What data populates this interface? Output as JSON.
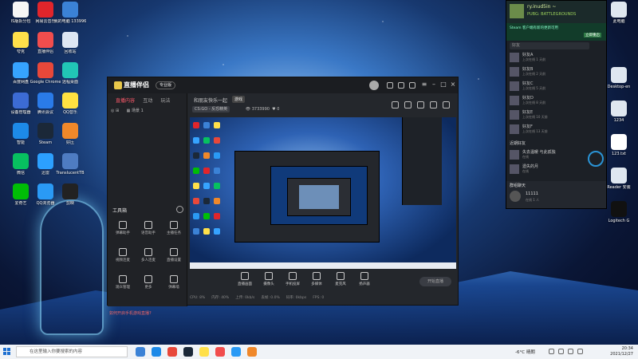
{
  "desktop": {
    "icons": [
      {
        "label": "IS版拆分包",
        "color": "#f6f6f6"
      },
      {
        "label": "网易云音乐",
        "color": "#e1252b"
      },
      {
        "label": "我的电脑 133996",
        "color": "#3b82d6"
      },
      {
        "label": "夸克",
        "color": "#ffe04a"
      },
      {
        "label": "直播伴侣",
        "color": "#f14d4d"
      },
      {
        "label": "回收站",
        "color": "#dde6f3"
      },
      {
        "label": "百度网盘",
        "color": "#36a3ff"
      },
      {
        "label": "Google Chrome",
        "color": "#e8483a"
      },
      {
        "label": "远程桌面",
        "color": "#21c6b6"
      },
      {
        "label": "设备管理器",
        "color": "#3c6bd4"
      },
      {
        "label": "腾讯会议",
        "color": "#2a7be8"
      },
      {
        "label": "QQ音乐",
        "color": "#ffe141"
      },
      {
        "label": "智能",
        "color": "#1d8ae8"
      },
      {
        "label": "Steam",
        "color": "#1b2838"
      },
      {
        "label": "好压",
        "color": "#f0882a"
      },
      {
        "label": "微信",
        "color": "#07c160"
      },
      {
        "label": "迅雷",
        "color": "#2ca0ff"
      },
      {
        "label": "TranslucentTB",
        "color": "#4e7cc2"
      },
      {
        "label": "爱奇艺",
        "color": "#00be06"
      },
      {
        "label": "QQ浏览器",
        "color": "#2a9af5"
      },
      {
        "label": "剪映",
        "color": "#222222"
      }
    ],
    "right_icons": [
      {
        "label": "此电脑",
        "color": "#dfe7f0"
      },
      {
        "label": "Desktop-en",
        "color": "#dfe7f0"
      },
      {
        "label": "1234",
        "color": "#dfe7f0"
      },
      {
        "label": "123.txt",
        "color": "#ffffff"
      },
      {
        "label": "Reader 安装",
        "color": "#dfe7f0"
      },
      {
        "label": "Logitech G",
        "color": "#111111"
      }
    ]
  },
  "app": {
    "title": "直播伴侣",
    "version": "专业版",
    "left_tabs": [
      "直播内容",
      "互动",
      "玩法"
    ],
    "active_tab": 0,
    "scene": "场景 1",
    "tools_title": "工具箱",
    "tools": [
      "弹幕助手",
      "语音助手",
      "主播任务",
      "视频连麦",
      "多人连麦",
      "直播设置",
      "观众管理",
      "更多",
      "弹幕墙"
    ],
    "notice": "如何开启手机游戏直播?",
    "top_title": "和朋友快乐一起",
    "top_tag": "游戏",
    "game": "CS:GO - 反恐精英",
    "views": "3733990",
    "likes": "0",
    "bottom_buttons": [
      "直播画面",
      "摄像头",
      "手机投屏",
      "多媒体",
      "麦克风",
      "扬声器"
    ],
    "go_live": "开始直播",
    "status": [
      "CPU: 8%",
      "内存: 40%",
      "上传: 0kb/s",
      "丢帧: 0.0%",
      "码率: 0kbps",
      "FPS: 0"
    ]
  },
  "steam": {
    "user": "ry.inud5in ~",
    "game": "PUBG: BATTLEGROUNDS",
    "banner_text": "Steam 客户端有新的更新可用",
    "banner_btn": "立即重启",
    "search": "好友",
    "friends": [
      {
        "name": "好友A",
        "status": "上次在线 1 天前"
      },
      {
        "name": "好友B",
        "status": "上次在线 2 天前"
      },
      {
        "name": "好友C",
        "status": "上次在线 5 天前"
      },
      {
        "name": "好友D",
        "status": "上次在线 8 天前"
      },
      {
        "name": "好友E",
        "status": "上次在线 10 天前"
      },
      {
        "name": "好友F",
        "status": "上次在线 13 天前"
      }
    ],
    "section_recent": "近期好友",
    "recent": [
      {
        "name": "失去温暖 与此孤独",
        "status": "在线"
      },
      {
        "name": "遗失的月",
        "status": "在线"
      }
    ],
    "group_header": "群组聊天",
    "group_name": "11111",
    "group_status": "在线 1 人"
  },
  "taskbar": {
    "search": "在这里输入你要搜索的内容",
    "weather": "-6°C 晴朗",
    "time": "20:34",
    "date": "2021/12/27"
  }
}
